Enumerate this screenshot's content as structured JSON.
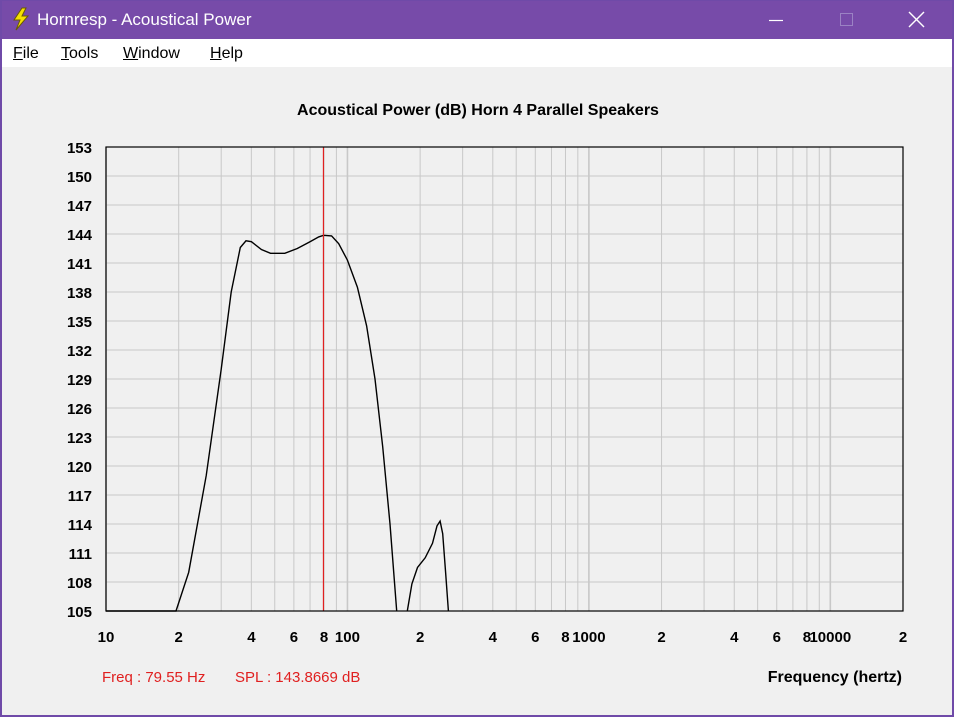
{
  "window": {
    "title": "Hornresp - Acoustical Power"
  },
  "menu": {
    "items": [
      {
        "label": "File",
        "mnemonic": "F",
        "rest": "ile"
      },
      {
        "label": "Tools",
        "mnemonic": "T",
        "rest": "ools"
      },
      {
        "label": "Window",
        "mnemonic": "W",
        "rest": "indow"
      },
      {
        "label": "Help",
        "mnemonic": "H",
        "rest": "elp"
      }
    ]
  },
  "status": {
    "freq": "Freq : 79.55 Hz",
    "spl": "SPL : 143.8669 dB"
  },
  "colors": {
    "titlebar": "#774ba9",
    "cursor": "#e02020",
    "curve": "#000000",
    "grid": "#c8c8c8"
  },
  "chart_data": {
    "type": "line",
    "title": "Acoustical Power (dB)   Horn   4 Parallel Speakers",
    "xlabel": "Frequency (hertz)",
    "ylabel": "",
    "x_scale": "log",
    "xlim": [
      10,
      20000
    ],
    "ylim": [
      105,
      153
    ],
    "y_ticks": [
      105,
      108,
      111,
      114,
      117,
      120,
      123,
      126,
      129,
      132,
      135,
      138,
      141,
      144,
      147,
      150,
      153
    ],
    "x_tick_labels": [
      {
        "value": 10,
        "label": "10"
      },
      {
        "value": 20,
        "label": "2"
      },
      {
        "value": 40,
        "label": "4"
      },
      {
        "value": 60,
        "label": "6"
      },
      {
        "value": 80,
        "label": "8"
      },
      {
        "value": 100,
        "label": "100"
      },
      {
        "value": 200,
        "label": "2"
      },
      {
        "value": 400,
        "label": "4"
      },
      {
        "value": 600,
        "label": "6"
      },
      {
        "value": 800,
        "label": "8"
      },
      {
        "value": 1000,
        "label": "1000"
      },
      {
        "value": 2000,
        "label": "2"
      },
      {
        "value": 4000,
        "label": "4"
      },
      {
        "value": 6000,
        "label": "6"
      },
      {
        "value": 8000,
        "label": "8"
      },
      {
        "value": 10000,
        "label": "10000"
      },
      {
        "value": 20000,
        "label": "2"
      }
    ],
    "grid": true,
    "cursor_x": 79.55,
    "series": [
      {
        "name": "",
        "segments": [
          [
            [
              10,
              105
            ],
            [
              19.5,
              105
            ],
            [
              22,
              109
            ],
            [
              26,
              119
            ],
            [
              30,
              130
            ],
            [
              33,
              138
            ],
            [
              36,
              142.6
            ],
            [
              38,
              143.3
            ],
            [
              40,
              143.2
            ],
            [
              44,
              142.4
            ],
            [
              48,
              142
            ],
            [
              55,
              142
            ],
            [
              62,
              142.5
            ],
            [
              70,
              143.2
            ],
            [
              76,
              143.7
            ],
            [
              79.55,
              143.87
            ],
            [
              86,
              143.8
            ],
            [
              92,
              143
            ],
            [
              100,
              141.3
            ],
            [
              110,
              138.5
            ],
            [
              120,
              134.5
            ],
            [
              130,
              129
            ],
            [
              140,
              122
            ],
            [
              150,
              114
            ],
            [
              160,
              105
            ]
          ],
          [
            [
              177,
              105
            ],
            [
              185,
              107.8
            ],
            [
              195,
              109.5
            ],
            [
              210,
              110.5
            ],
            [
              225,
              112
            ],
            [
              235,
              113.8
            ],
            [
              242,
              114.3
            ],
            [
              248,
              113
            ],
            [
              255,
              109
            ],
            [
              262,
              105
            ]
          ]
        ]
      }
    ]
  }
}
